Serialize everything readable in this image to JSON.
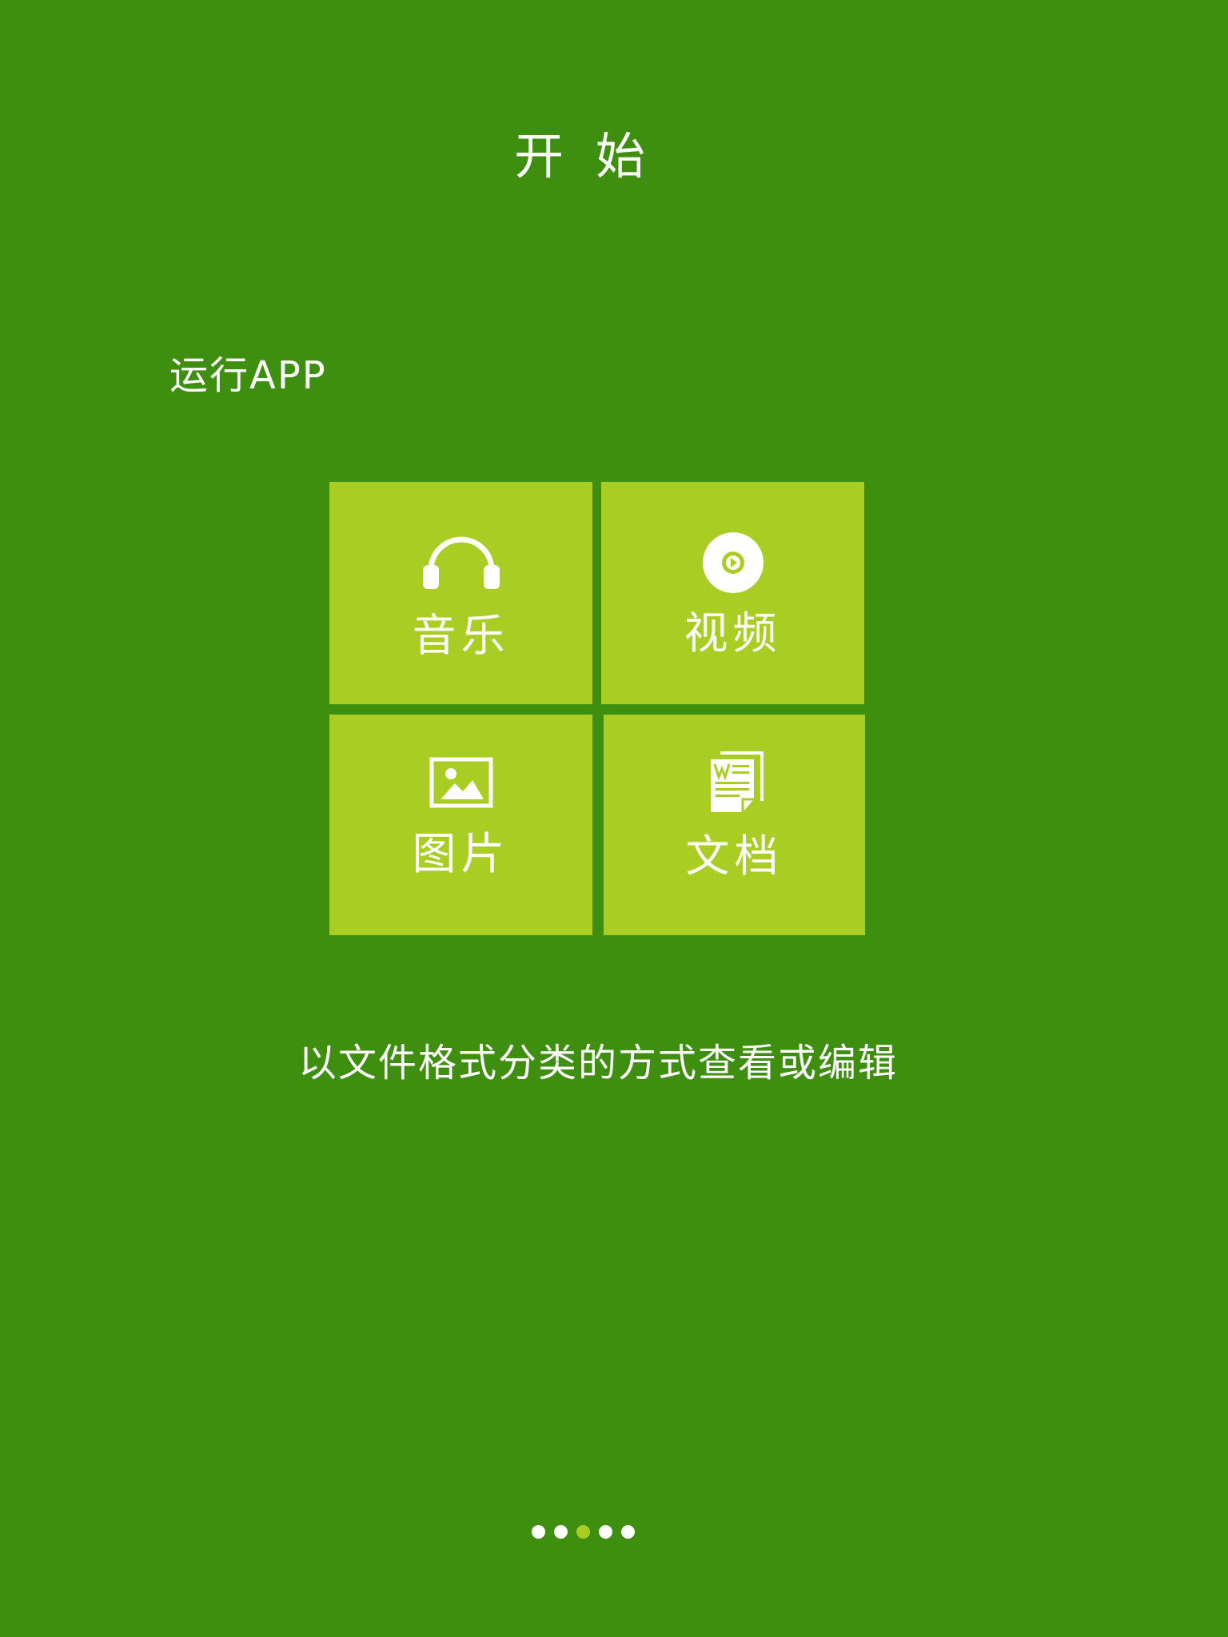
{
  "header": {
    "title": "开 始"
  },
  "intro": {
    "label": "运行APP"
  },
  "tiles": [
    {
      "label": "音乐",
      "icon": "headphones-icon"
    },
    {
      "label": "视频",
      "icon": "play-disc-icon"
    },
    {
      "label": "图片",
      "icon": "picture-icon"
    },
    {
      "label": "文档",
      "icon": "word-document-icon"
    }
  ],
  "description": "以文件格式分类的方式查看或编辑",
  "pagination": {
    "total": 5,
    "active_index": 2
  },
  "colors": {
    "background": "#3e8e0f",
    "tile": "#a9cd22",
    "text": "#ffffff",
    "active_dot": "#a9cd22"
  }
}
